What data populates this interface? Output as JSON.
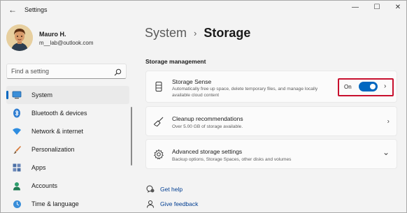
{
  "window": {
    "title": "Settings",
    "back_glyph": "←",
    "minimize_glyph": "—",
    "maximize_glyph": "☐",
    "close_glyph": "✕"
  },
  "profile": {
    "name": "Mauro H.",
    "email": "m__lab@outlook.com"
  },
  "search": {
    "placeholder": "Find a setting",
    "icon": "search-icon"
  },
  "sidebar": {
    "items": [
      {
        "label": "System",
        "icon": "monitor-icon",
        "active": true
      },
      {
        "label": "Bluetooth & devices",
        "icon": "bluetooth-icon",
        "active": false
      },
      {
        "label": "Network & internet",
        "icon": "network-icon",
        "active": false
      },
      {
        "label": "Personalization",
        "icon": "brush-icon",
        "active": false
      },
      {
        "label": "Apps",
        "icon": "apps-icon",
        "active": false
      },
      {
        "label": "Accounts",
        "icon": "person-icon",
        "active": false
      },
      {
        "label": "Time & language",
        "icon": "globe-clock-icon",
        "active": false
      }
    ]
  },
  "main": {
    "breadcrumb": {
      "root": "System",
      "separator": "›",
      "current": "Storage"
    },
    "section_title": "Storage management",
    "cards": {
      "storage_sense": {
        "title": "Storage Sense",
        "description": "Automatically free up space, delete temporary files, and manage locally available cloud content",
        "toggle_label": "On",
        "toggle_on": true,
        "chevron": "›"
      },
      "cleanup": {
        "title": "Cleanup recommendations",
        "description": "Over 5.00 GB of storage available.",
        "chevron": "›"
      },
      "advanced": {
        "title": "Advanced storage settings",
        "description": "Backup options, Storage Spaces, other disks and volumes",
        "chevron": "⌄"
      }
    },
    "links": {
      "get_help": "Get help",
      "give_feedback": "Give feedback"
    }
  },
  "colors": {
    "accent": "#0067c0",
    "highlight_border": "#c8102e",
    "link": "#003e92",
    "window_bg": "#f3f3f3",
    "card_bg": "#fbfbfb"
  }
}
